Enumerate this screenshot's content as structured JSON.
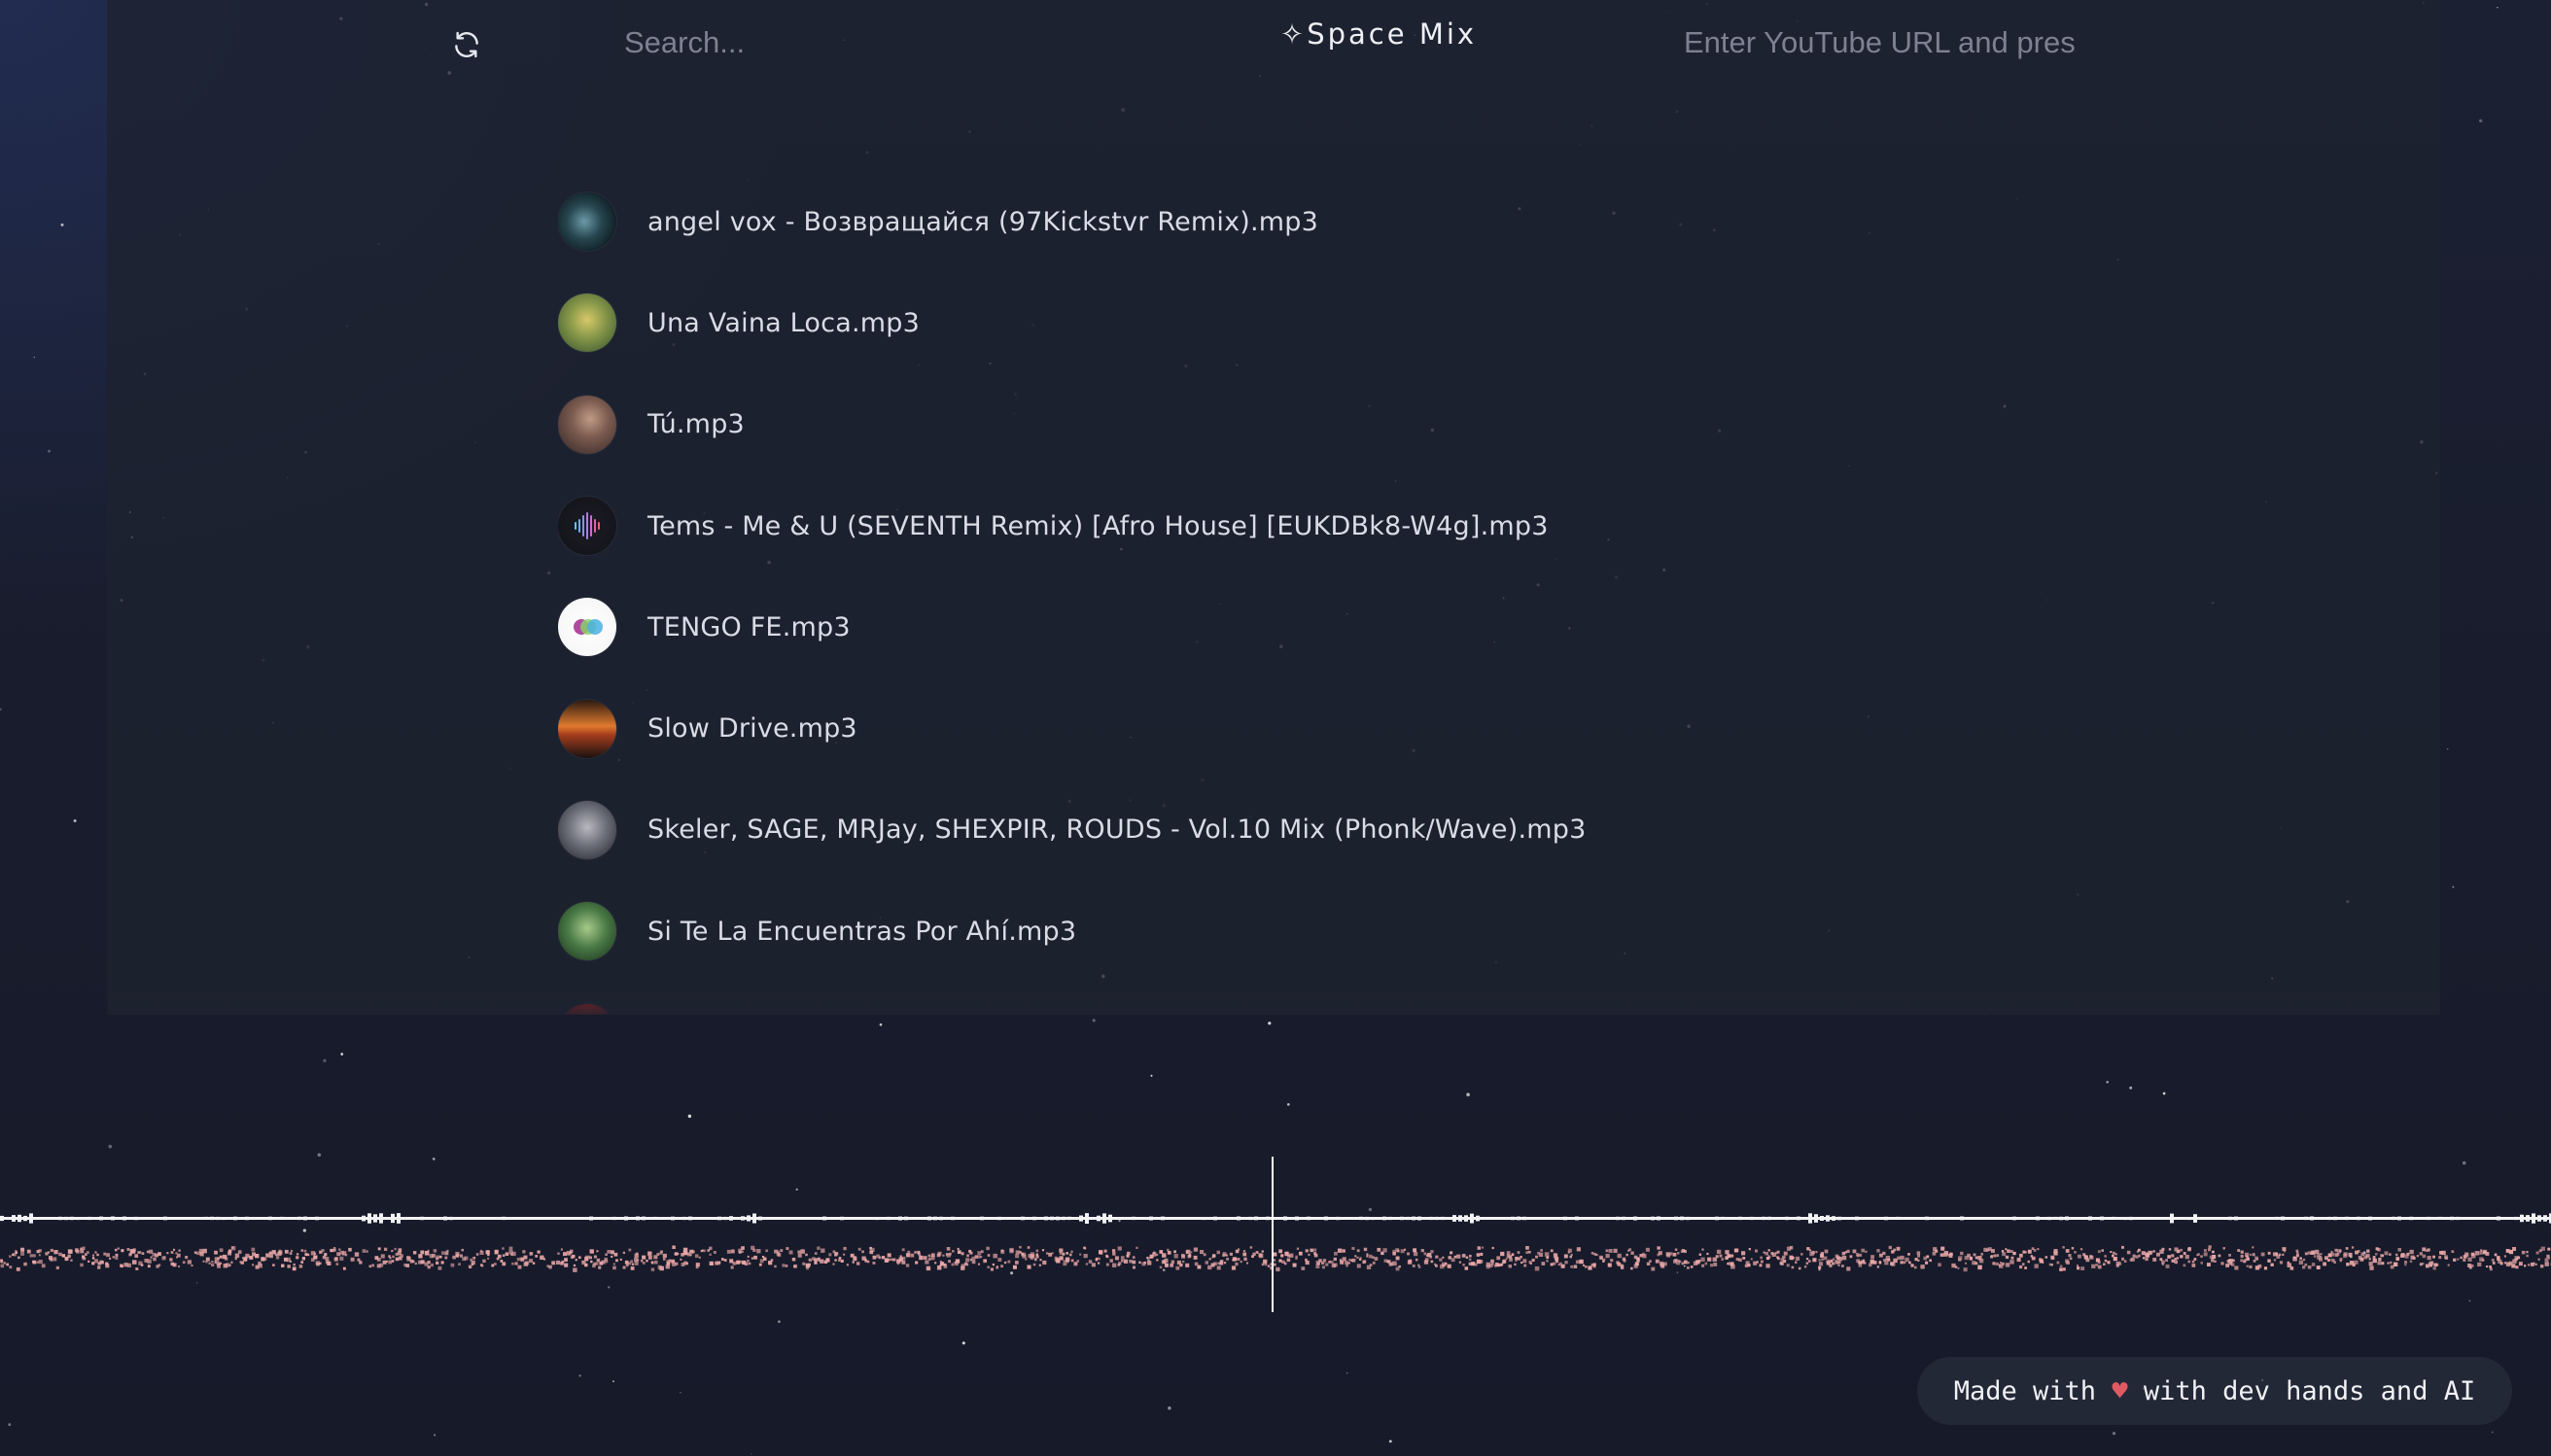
{
  "header": {
    "refresh_icon": "refresh-icon",
    "search_placeholder": "Search...",
    "brand_title": "✧Space Mix",
    "url_placeholder": "Enter YouTube URL and pres"
  },
  "tracks": [
    {
      "name": "angel vox - Возвращайся (97Kickstvr Remix).mp3",
      "thumb": "dark-teal-cover"
    },
    {
      "name": "Una Vaina Loca.mp3",
      "thumb": "green-yellow-cover"
    },
    {
      "name": "Tú.mp3",
      "thumb": "portrait-cover"
    },
    {
      "name": "Tems - Me & U (SEVENTH Remix) [Afro House] [EUKDBk8-W4g].mp3",
      "thumb": "soundwave-cover"
    },
    {
      "name": "TENGO FE.mp3",
      "thumb": "white-circles-cover"
    },
    {
      "name": "Slow Drive.mp3",
      "thumb": "sunset-cover"
    },
    {
      "name": "Skeler, SAGE, MRJay, SHEXPIR, ROUDS - Vol.10 Mix (Phonk/Wave).mp3",
      "thumb": "grey-cover"
    },
    {
      "name": "Si Te La Encuentras Por Ahí.mp3",
      "thumb": "green-cover"
    },
    {
      "name": "",
      "thumb": "red-cover"
    }
  ],
  "footer": {
    "credit_prefix": "Made with ",
    "heart": "♥",
    "credit_suffix": " with dev hands and AI"
  },
  "colors": {
    "background": "#181c2c",
    "panel": "#1e2230",
    "text": "#d9dce5",
    "waveform_primary": "#f2f2f4",
    "waveform_secondary": "#e8a6a6",
    "heart": "#e05a64"
  }
}
